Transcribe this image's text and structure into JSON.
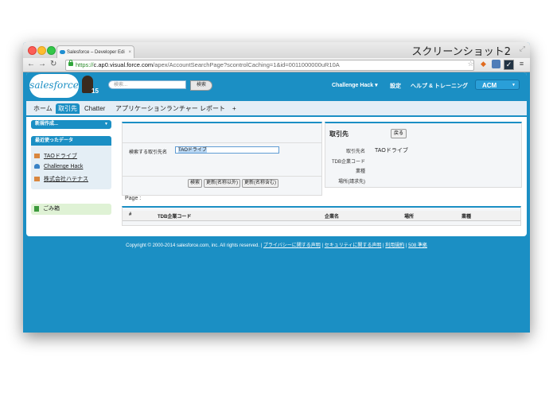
{
  "window": {
    "title": "スクリーンショット2",
    "tab_title": "Salesforce – Developer Edi",
    "tab_close": "×",
    "url_scheme": "https://",
    "url_host": "c.ap0.visual.force.com",
    "url_path": "/apex/AccountSearchPage?scontrolCaching=1&id=0011000000uR10A"
  },
  "header": {
    "logo": "salesforce",
    "version_badge": "15",
    "search_placeholder": "検索...",
    "search_button": "検索",
    "user_menu": "Challenge Hack ▾",
    "setup": "設定",
    "help": "ヘルプ & トレーニング",
    "app_menu": "ACM"
  },
  "tabs": [
    "ホーム",
    "取引先",
    "Chatter",
    "アプリケーションランチャー",
    "レポート",
    "+"
  ],
  "sidebar": {
    "new_button": "新規作成...",
    "recent_title": "最近使ったデータ",
    "recent_items": [
      "TAOドライブ",
      "Challenge Hack",
      "株式会社ハテナス"
    ],
    "trash": "ごみ箱"
  },
  "search_panel": {
    "label": "検索する取引先名",
    "input_value": "TAOドライブ",
    "buttons": [
      "検索",
      "更新(名称以外)",
      "更新(名称含む)"
    ]
  },
  "detail_panel": {
    "title": "取引先",
    "back_button": "戻る",
    "fields": [
      {
        "label": "取引先名",
        "value": "TAOドライブ"
      },
      {
        "label": "TDB企業コード",
        "value": ""
      },
      {
        "label": "業種",
        "value": ""
      },
      {
        "label": "場所(請求先)",
        "value": ""
      }
    ]
  },
  "results": {
    "page_label": "Page :",
    "columns": [
      "#",
      "TDB企業コード",
      "企業名",
      "場所",
      "業種"
    ]
  },
  "footer": {
    "copyright": "Copyright © 2000-2014 salesforce.com, inc. All rights reserved. | ",
    "links": [
      "プライバシーに関する声明",
      "セキュリティに関する声明",
      "利用規約",
      "508 準拠"
    ]
  }
}
